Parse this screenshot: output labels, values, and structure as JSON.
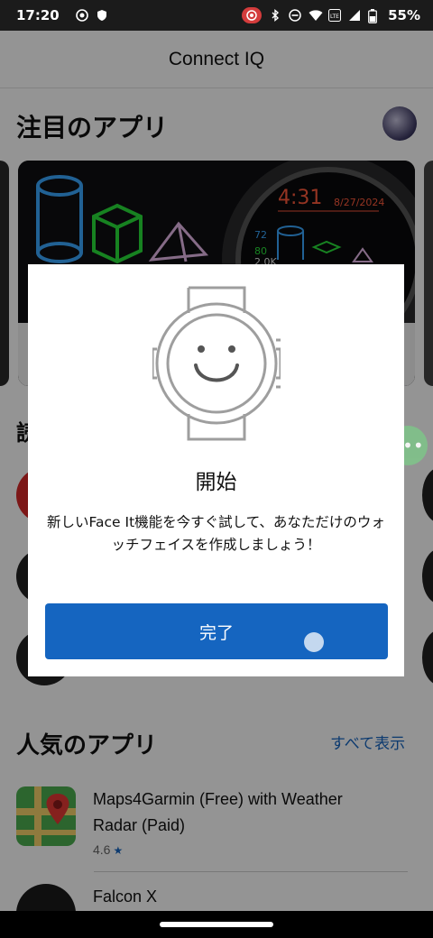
{
  "status_bar": {
    "time": "17:20",
    "battery": "55%",
    "left_icons": [
      "camera-dot-icon",
      "shield-icon"
    ],
    "right_icons": [
      "screen-record-icon",
      "bluetooth-icon",
      "do-not-disturb-icon",
      "wifi-icon",
      "lte-icon",
      "signal-icon",
      "battery-icon"
    ]
  },
  "app_bar": {
    "title": "Connect IQ"
  },
  "featured": {
    "title": "注目のアプリ"
  },
  "hero": {
    "time": "4:31",
    "date": "8/27/2024",
    "stat1": "72",
    "stat2": "80",
    "stat3": "2.0K"
  },
  "middle_section": {
    "title_partial": "読"
  },
  "popular": {
    "title": "人気のアプリ",
    "see_all": "すべて表示",
    "apps": [
      {
        "name": "Maps4Garmin (Free) with Weather Radar (Paid)",
        "rating": "4.6"
      },
      {
        "name": "Falcon X"
      }
    ]
  },
  "dialog": {
    "title": "開始",
    "body": "新しいFace It機能を今すぐ試して、あなただけのウォッチフェイスを作成しましょう！",
    "button": "完了"
  },
  "colors": {
    "accent": "#1565c0",
    "scrim": "rgba(0,0,0,0.42)"
  }
}
